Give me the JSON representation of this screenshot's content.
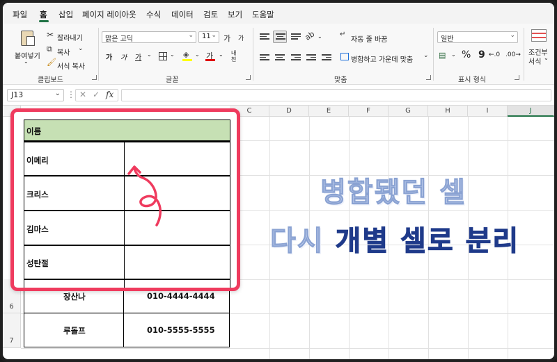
{
  "ribbon_tabs": [
    "파일",
    "홈",
    "삽입",
    "페이지 레이아웃",
    "수식",
    "데이터",
    "검토",
    "보기",
    "도움말"
  ],
  "active_tab": "홈",
  "clipboard": {
    "paste": "붙여넣기",
    "cut": "잘라내기",
    "copy": "복사",
    "format_painter": "서식 복사",
    "group": "클립보드"
  },
  "font": {
    "name": "맑은 고딕",
    "size": "11",
    "grow": "가",
    "shrink": "가",
    "bold": "가",
    "italic": "가",
    "underline": "가",
    "color_glyph": "가",
    "phonetic": "내천",
    "group": "글꼴"
  },
  "alignment": {
    "wrap_text": "자동 줄 바꿈",
    "merge_center": "병합하고 가운데 맞춤",
    "group": "맞춤"
  },
  "number": {
    "format": "일반",
    "percent": "%",
    "comma": "9",
    "group": "표시 형식"
  },
  "styles": {
    "conditional": "조건부",
    "format": "서식"
  },
  "formula_bar": {
    "name_box": "J13",
    "fx": "fx",
    "value": ""
  },
  "columns": [
    "C",
    "D",
    "E",
    "F",
    "G",
    "H",
    "I",
    "J"
  ],
  "selected_column": "J",
  "rows": [
    "6",
    "7"
  ],
  "card_table": {
    "header": "이름",
    "names": [
      "이메리",
      "크리스",
      "김마스",
      "성탄절"
    ],
    "header_color": "#c6e0b4"
  },
  "sheet_rows": [
    {
      "name": "장산나",
      "phone": "010-4444-4444"
    },
    {
      "name": "루돌프",
      "phone": "010-5555-5555"
    }
  ],
  "overlay": {
    "line1": "병합됐던 셀",
    "line2_a": "다시 ",
    "line2_b": "개별 셀로 분리"
  },
  "colors": {
    "accent_green": "#217346",
    "card_border": "#ef3b5e",
    "arrow": "#ef3b5e",
    "title_light": "#b9c9ea",
    "title_dark": "#1f3a8a"
  }
}
